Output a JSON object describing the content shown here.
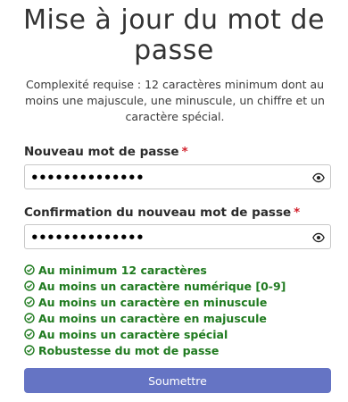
{
  "page": {
    "title_line1": "Mise à jour du mot de",
    "title_line2": "passe",
    "description": "Complexité requise : 12 caractères minimum dont au moins une majuscule, une minuscule, un chiffre et un caractère spécial."
  },
  "fields": {
    "new_password": {
      "label": "Nouveau mot de passe",
      "required_mark": "*",
      "value": "••••••••••••••"
    },
    "confirm_password": {
      "label": "Confirmation du nouveau mot de passe",
      "required_mark": "*",
      "value": "••••••••••••••"
    }
  },
  "rules": [
    "Au minimum 12 caractères",
    "Au moins un caractère numérique [0-9]",
    "Au moins un caractère en minuscule",
    "Au moins un caractère en majuscule",
    "Au moins un caractère spécial",
    "Robustesse du mot de passe"
  ],
  "submit_label": "Soumettre",
  "colors": {
    "accent": "#6574c4",
    "valid": "#1f7a1f",
    "required": "#d2222d"
  },
  "icons": {
    "toggle_visibility": "eye-icon",
    "rule_ok": "check-circle-icon"
  }
}
